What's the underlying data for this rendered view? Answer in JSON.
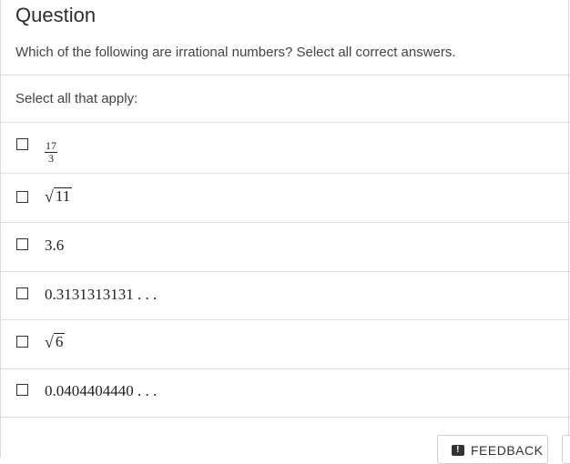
{
  "header": {
    "title": "Question"
  },
  "question": {
    "prompt": "Which of the following are irrational numbers? Select all correct answers.",
    "instruction": "Select all that apply:"
  },
  "options": [
    {
      "type": "fraction",
      "numerator": "17",
      "denominator": "3",
      "checked": false
    },
    {
      "type": "sqrt",
      "radicand": "11",
      "checked": false
    },
    {
      "type": "text",
      "text": "3.6",
      "checked": false
    },
    {
      "type": "text",
      "text": "0.3131313131 . . .",
      "checked": false
    },
    {
      "type": "sqrt",
      "radicand": "6",
      "checked": false
    },
    {
      "type": "text",
      "text": "0.0404404440 . . .",
      "checked": false
    }
  ],
  "footer": {
    "feedback_label": "FEEDBACK",
    "feedback_icon": "feedback-icon"
  }
}
